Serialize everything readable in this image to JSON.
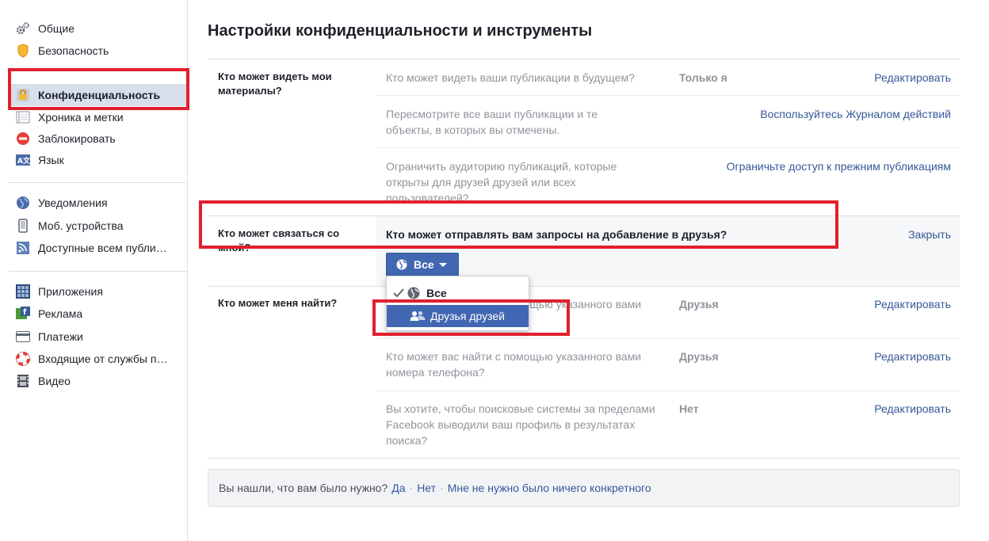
{
  "sidebar": {
    "items": [
      {
        "label": "Общие",
        "icon": "gear-icon"
      },
      {
        "label": "Безопасность",
        "icon": "badge-icon"
      },
      {
        "label": "Конфиденциальность",
        "icon": "lock-icon"
      },
      {
        "label": "Хроника и метки",
        "icon": "timeline-icon"
      },
      {
        "label": "Заблокировать",
        "icon": "block-icon"
      },
      {
        "label": "Язык",
        "icon": "language-icon"
      },
      {
        "label": "Уведомления",
        "icon": "globe-icon"
      },
      {
        "label": "Моб. устройства",
        "icon": "mobile-icon"
      },
      {
        "label": "Доступные всем публи…",
        "icon": "rss-icon"
      },
      {
        "label": "Приложения",
        "icon": "apps-icon"
      },
      {
        "label": "Реклама",
        "icon": "ads-icon"
      },
      {
        "label": "Платежи",
        "icon": "card-icon"
      },
      {
        "label": "Входящие от службы п…",
        "icon": "lifebuoy-icon"
      },
      {
        "label": "Видео",
        "icon": "film-icon"
      }
    ]
  },
  "main": {
    "title": "Настройки конфиденциальности и инструменты",
    "sections": [
      {
        "label": "Кто может видеть мои материалы?",
        "rows": [
          {
            "question": "Кто может видеть ваши публикации в будущем?",
            "value": "Только я",
            "action": "Редактировать"
          },
          {
            "question": "Пересмотрите все ваши публикации и те объекты, в которых вы отмечены.",
            "value": "",
            "action": "Воспользуйтесь Журналом действий"
          },
          {
            "question": "Ограничить аудиторию публикаций, которые открыты для друзей друзей или всех пользователей?",
            "value": "",
            "action": "Ограничьте доступ к прежним публикациям"
          }
        ]
      },
      {
        "label": "Кто может связаться со мной?",
        "expanded_question": "Кто может отправлять вам запросы на добавление в друзья?",
        "close_label": "Закрыть",
        "selector_value": "Все",
        "dropdown": [
          {
            "label": "Все",
            "checked": true
          },
          {
            "label": "Друзья друзей",
            "checked": false
          }
        ]
      },
      {
        "label": "Кто может меня найти?",
        "rows": [
          {
            "question": "Кто может вас найти с помощью указанного вами электронного адреса?",
            "value": "Друзья",
            "action": "Редактировать"
          },
          {
            "question": "Кто может вас найти с помощью указанного вами номера телефона?",
            "value": "Друзья",
            "action": "Редактировать"
          },
          {
            "question": "Вы хотите, чтобы поисковые системы за пределами Facebook выводили ваш профиль в результатах поиска?",
            "value": "Нет",
            "action": "Редактировать"
          }
        ]
      }
    ]
  },
  "footer": {
    "prompt": "Вы нашли, что вам было нужно?",
    "yes": "Да",
    "no": "Нет",
    "nothing": "Мне не нужно было ничего конкретного"
  },
  "colors": {
    "accent": "#4267b2",
    "link": "#365899",
    "highlight": "#e0202e",
    "active_bg": "#d8dfea"
  }
}
